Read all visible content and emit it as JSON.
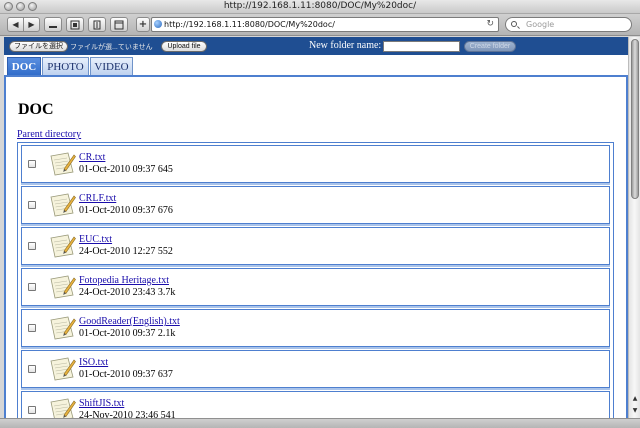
{
  "window": {
    "title": "http://192.168.1.11:8080/DOC/My%20doc/"
  },
  "toolbar": {
    "url": "http://192.168.1.11:8080/DOC/My%20doc/",
    "search_placeholder": "Google",
    "add_label": "+",
    "back_label": "◀",
    "forward_label": "▶",
    "reload_label": "↻"
  },
  "upload": {
    "choose_label": "ファイルを選択",
    "no_file_text": "ファイルが選...ていません",
    "upload_label": "Upload file",
    "folder_label": "New folder name:",
    "create_label": "Create folder"
  },
  "tabs": [
    {
      "label": "DOC",
      "active": true
    },
    {
      "label": "PHOTO",
      "active": false
    },
    {
      "label": "VIDEO",
      "active": false
    }
  ],
  "page": {
    "title": "DOC",
    "parent_link": "Parent directory"
  },
  "files": [
    {
      "name": "CR.txt",
      "meta": "01-Oct-2010 09:37 645"
    },
    {
      "name": "CRLF.txt",
      "meta": "01-Oct-2010 09:37 676"
    },
    {
      "name": "EUC.txt",
      "meta": "24-Oct-2010 12:27 552"
    },
    {
      "name": "Fotopedia Heritage.txt",
      "meta": "24-Oct-2010 23:43 3.7k"
    },
    {
      "name": "GoodReader(English).txt",
      "meta": "01-Oct-2010 09:37 2.1k"
    },
    {
      "name": "ISO.txt",
      "meta": "01-Oct-2010 09:37 637"
    },
    {
      "name": "ShiftJIS.txt",
      "meta": "24-Nov-2010 23:46 541"
    }
  ]
}
